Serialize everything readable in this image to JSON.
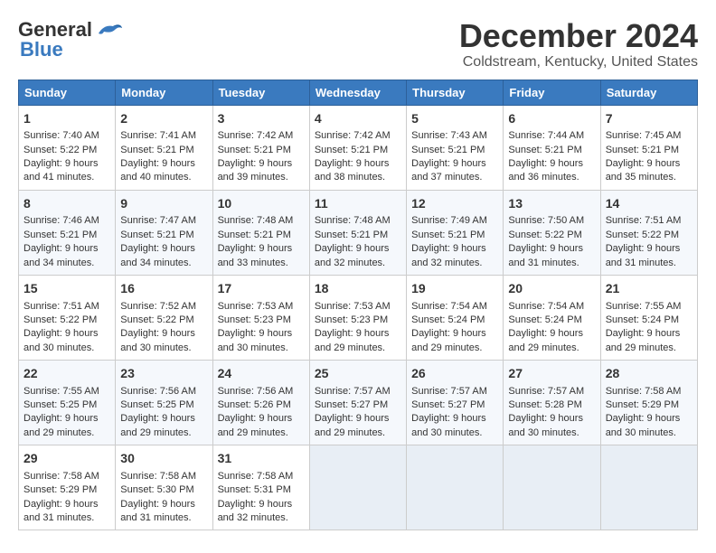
{
  "logo": {
    "line1": "General",
    "line2": "Blue"
  },
  "title": "December 2024",
  "subtitle": "Coldstream, Kentucky, United States",
  "days_header": [
    "Sunday",
    "Monday",
    "Tuesday",
    "Wednesday",
    "Thursday",
    "Friday",
    "Saturday"
  ],
  "weeks": [
    [
      {
        "day": "1",
        "sunrise": "Sunrise: 7:40 AM",
        "sunset": "Sunset: 5:22 PM",
        "daylight": "Daylight: 9 hours and 41 minutes."
      },
      {
        "day": "2",
        "sunrise": "Sunrise: 7:41 AM",
        "sunset": "Sunset: 5:21 PM",
        "daylight": "Daylight: 9 hours and 40 minutes."
      },
      {
        "day": "3",
        "sunrise": "Sunrise: 7:42 AM",
        "sunset": "Sunset: 5:21 PM",
        "daylight": "Daylight: 9 hours and 39 minutes."
      },
      {
        "day": "4",
        "sunrise": "Sunrise: 7:42 AM",
        "sunset": "Sunset: 5:21 PM",
        "daylight": "Daylight: 9 hours and 38 minutes."
      },
      {
        "day": "5",
        "sunrise": "Sunrise: 7:43 AM",
        "sunset": "Sunset: 5:21 PM",
        "daylight": "Daylight: 9 hours and 37 minutes."
      },
      {
        "day": "6",
        "sunrise": "Sunrise: 7:44 AM",
        "sunset": "Sunset: 5:21 PM",
        "daylight": "Daylight: 9 hours and 36 minutes."
      },
      {
        "day": "7",
        "sunrise": "Sunrise: 7:45 AM",
        "sunset": "Sunset: 5:21 PM",
        "daylight": "Daylight: 9 hours and 35 minutes."
      }
    ],
    [
      {
        "day": "8",
        "sunrise": "Sunrise: 7:46 AM",
        "sunset": "Sunset: 5:21 PM",
        "daylight": "Daylight: 9 hours and 34 minutes."
      },
      {
        "day": "9",
        "sunrise": "Sunrise: 7:47 AM",
        "sunset": "Sunset: 5:21 PM",
        "daylight": "Daylight: 9 hours and 34 minutes."
      },
      {
        "day": "10",
        "sunrise": "Sunrise: 7:48 AM",
        "sunset": "Sunset: 5:21 PM",
        "daylight": "Daylight: 9 hours and 33 minutes."
      },
      {
        "day": "11",
        "sunrise": "Sunrise: 7:48 AM",
        "sunset": "Sunset: 5:21 PM",
        "daylight": "Daylight: 9 hours and 32 minutes."
      },
      {
        "day": "12",
        "sunrise": "Sunrise: 7:49 AM",
        "sunset": "Sunset: 5:21 PM",
        "daylight": "Daylight: 9 hours and 32 minutes."
      },
      {
        "day": "13",
        "sunrise": "Sunrise: 7:50 AM",
        "sunset": "Sunset: 5:22 PM",
        "daylight": "Daylight: 9 hours and 31 minutes."
      },
      {
        "day": "14",
        "sunrise": "Sunrise: 7:51 AM",
        "sunset": "Sunset: 5:22 PM",
        "daylight": "Daylight: 9 hours and 31 minutes."
      }
    ],
    [
      {
        "day": "15",
        "sunrise": "Sunrise: 7:51 AM",
        "sunset": "Sunset: 5:22 PM",
        "daylight": "Daylight: 9 hours and 30 minutes."
      },
      {
        "day": "16",
        "sunrise": "Sunrise: 7:52 AM",
        "sunset": "Sunset: 5:22 PM",
        "daylight": "Daylight: 9 hours and 30 minutes."
      },
      {
        "day": "17",
        "sunrise": "Sunrise: 7:53 AM",
        "sunset": "Sunset: 5:23 PM",
        "daylight": "Daylight: 9 hours and 30 minutes."
      },
      {
        "day": "18",
        "sunrise": "Sunrise: 7:53 AM",
        "sunset": "Sunset: 5:23 PM",
        "daylight": "Daylight: 9 hours and 29 minutes."
      },
      {
        "day": "19",
        "sunrise": "Sunrise: 7:54 AM",
        "sunset": "Sunset: 5:24 PM",
        "daylight": "Daylight: 9 hours and 29 minutes."
      },
      {
        "day": "20",
        "sunrise": "Sunrise: 7:54 AM",
        "sunset": "Sunset: 5:24 PM",
        "daylight": "Daylight: 9 hours and 29 minutes."
      },
      {
        "day": "21",
        "sunrise": "Sunrise: 7:55 AM",
        "sunset": "Sunset: 5:24 PM",
        "daylight": "Daylight: 9 hours and 29 minutes."
      }
    ],
    [
      {
        "day": "22",
        "sunrise": "Sunrise: 7:55 AM",
        "sunset": "Sunset: 5:25 PM",
        "daylight": "Daylight: 9 hours and 29 minutes."
      },
      {
        "day": "23",
        "sunrise": "Sunrise: 7:56 AM",
        "sunset": "Sunset: 5:25 PM",
        "daylight": "Daylight: 9 hours and 29 minutes."
      },
      {
        "day": "24",
        "sunrise": "Sunrise: 7:56 AM",
        "sunset": "Sunset: 5:26 PM",
        "daylight": "Daylight: 9 hours and 29 minutes."
      },
      {
        "day": "25",
        "sunrise": "Sunrise: 7:57 AM",
        "sunset": "Sunset: 5:27 PM",
        "daylight": "Daylight: 9 hours and 29 minutes."
      },
      {
        "day": "26",
        "sunrise": "Sunrise: 7:57 AM",
        "sunset": "Sunset: 5:27 PM",
        "daylight": "Daylight: 9 hours and 30 minutes."
      },
      {
        "day": "27",
        "sunrise": "Sunrise: 7:57 AM",
        "sunset": "Sunset: 5:28 PM",
        "daylight": "Daylight: 9 hours and 30 minutes."
      },
      {
        "day": "28",
        "sunrise": "Sunrise: 7:58 AM",
        "sunset": "Sunset: 5:29 PM",
        "daylight": "Daylight: 9 hours and 30 minutes."
      }
    ],
    [
      {
        "day": "29",
        "sunrise": "Sunrise: 7:58 AM",
        "sunset": "Sunset: 5:29 PM",
        "daylight": "Daylight: 9 hours and 31 minutes."
      },
      {
        "day": "30",
        "sunrise": "Sunrise: 7:58 AM",
        "sunset": "Sunset: 5:30 PM",
        "daylight": "Daylight: 9 hours and 31 minutes."
      },
      {
        "day": "31",
        "sunrise": "Sunrise: 7:58 AM",
        "sunset": "Sunset: 5:31 PM",
        "daylight": "Daylight: 9 hours and 32 minutes."
      },
      null,
      null,
      null,
      null
    ]
  ]
}
